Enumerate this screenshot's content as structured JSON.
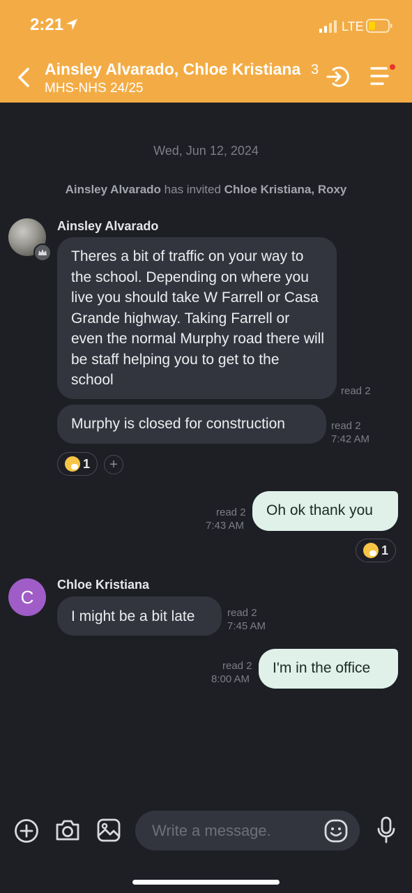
{
  "status_bar": {
    "time": "2:21",
    "network": "LTE"
  },
  "header": {
    "title": "Ainsley Alvarado, Chloe Kristiana",
    "member_count": "3",
    "subtitle": "MHS-NHS 24/25"
  },
  "conversation": {
    "date": "Wed, Jun 12, 2024",
    "system_message": {
      "inviter": "Ainsley Alvarado",
      "action": "has invited",
      "invitees": "Chloe Kristiana, Roxy"
    },
    "messages": [
      {
        "sender": "Ainsley Alvarado",
        "text": "Theres a bit of traffic on your way to the school. Depending on where you live you should take W Farrell or Casa Grande highway. Taking Farrell or even the normal Murphy road there will be staff helping you to get to the school",
        "read": "read 2",
        "time": ""
      },
      {
        "sender": "Ainsley Alvarado",
        "text": "Murphy is closed for construction",
        "read": "read 2",
        "time": "7:42 AM",
        "reaction_count": "1"
      },
      {
        "sender": "me",
        "text": "Oh ok thank you",
        "read": "read 2",
        "time": "7:43 AM",
        "reaction_count": "1"
      },
      {
        "sender": "Chloe Kristiana",
        "avatar_letter": "C",
        "text": "I might be a bit late",
        "read": "read 2",
        "time": "7:45 AM"
      },
      {
        "sender": "me",
        "text": "I'm in the office",
        "read": "read 2",
        "time": "8:00 AM"
      }
    ]
  },
  "composer": {
    "placeholder": "Write a message."
  },
  "colors": {
    "header": "#f3ac45",
    "background": "#1e1f25",
    "incoming_bubble": "#33353e",
    "outgoing_bubble": "#dff1e9",
    "avatar_c": "#a05cc7"
  },
  "icons": [
    "location-arrow-icon",
    "signal-icon",
    "battery-icon",
    "back-icon",
    "exit-icon",
    "menu-icon",
    "crown-icon",
    "emoji-icon",
    "add-reaction-icon",
    "plus-icon",
    "camera-icon",
    "image-icon",
    "smile-icon",
    "mic-icon"
  ]
}
